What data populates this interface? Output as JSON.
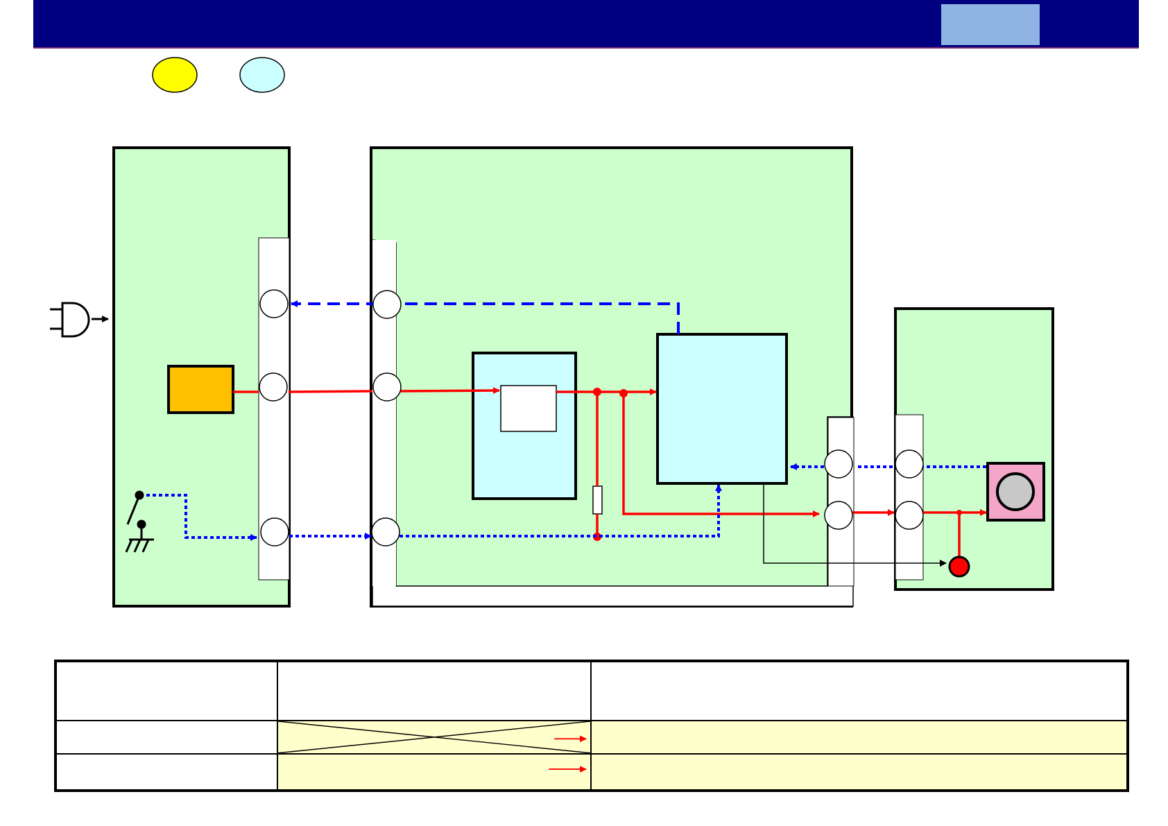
{
  "colors": {
    "header": "#000080",
    "header_tab": "#8fb4e3",
    "board_fill": "#ccffcc",
    "ic_fill": "#ccffff",
    "connector_fill": "#ffffff",
    "power_line": "#ff0000",
    "signal_line": "#0000ff",
    "battery": "#ffc000",
    "speaker_box": "#f4a6c8",
    "legend_yellow": "#ffff00",
    "legend_cyan": "#ccffff",
    "table_row_fill": "#ffffcc"
  },
  "icons": {
    "plug": "ac-plug-icon",
    "switch": "ground-switch-icon",
    "speaker": "speaker-icon",
    "led": "red-led-icon"
  },
  "table": {
    "headers": [
      "",
      "",
      ""
    ],
    "rows": [
      {
        "col_a": "",
        "col_b_crossed": true,
        "col_c": ""
      },
      {
        "col_a": "",
        "col_b_crossed": false,
        "col_c": ""
      }
    ]
  }
}
